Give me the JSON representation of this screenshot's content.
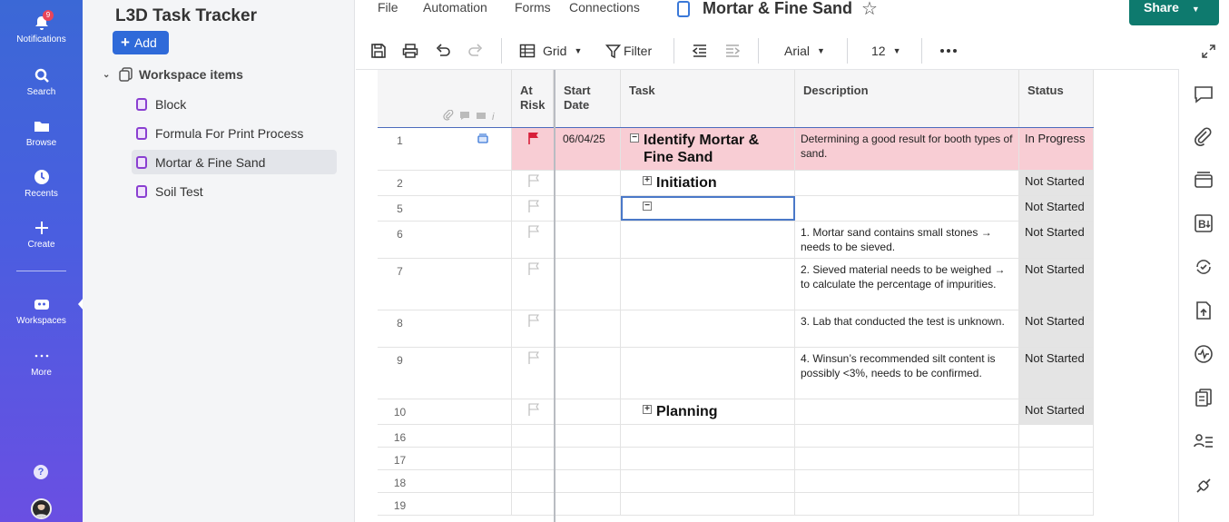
{
  "rail": {
    "notifications": {
      "label": "Notifications",
      "badge": "9"
    },
    "search": {
      "label": "Search"
    },
    "browse": {
      "label": "Browse"
    },
    "recents": {
      "label": "Recents"
    },
    "create": {
      "label": "Create"
    },
    "workspaces": {
      "label": "Workspaces"
    },
    "more": {
      "label": "More"
    },
    "help": "?"
  },
  "sidebar": {
    "workspace_title": "L3D Task Tracker",
    "add_label": "Add",
    "root_label": "Workspace items",
    "items": [
      {
        "label": "Block"
      },
      {
        "label": "Formula For Print Process"
      },
      {
        "label": "Mortar & Fine Sand",
        "selected": true
      },
      {
        "label": "Soil Test"
      }
    ]
  },
  "menubar": {
    "file": "File",
    "automation": "Automation",
    "forms": "Forms",
    "connections": "Connections",
    "doc_title": "Mortar & Fine Sand",
    "share": "Share"
  },
  "toolbar": {
    "view": "Grid",
    "filter": "Filter",
    "font": "Arial",
    "size": "12"
  },
  "grid": {
    "columns": {
      "at_risk": "At Risk",
      "start_date": "Start Date",
      "task": "Task",
      "description": "Description",
      "status": "Status"
    },
    "rows": [
      {
        "num": "1",
        "flag": "red",
        "start": "06/04/25",
        "task": "Identify Mortar & Fine Sand",
        "level": 0,
        "toggle": "minus",
        "desc": "Determining a good result for booth types of sand.",
        "status": "In Progress",
        "highlight": true
      },
      {
        "num": "2",
        "flag": "empty",
        "start": "",
        "task": "Initiation",
        "level": 1,
        "toggle": "plus",
        "desc": "",
        "status": "Not Started"
      },
      {
        "num": "5",
        "flag": "empty",
        "start": "",
        "task": "",
        "level": 1,
        "toggle": "minus",
        "desc": "",
        "status": "Not Started",
        "selected": true
      },
      {
        "num": "6",
        "flag": "empty",
        "start": "",
        "task": "",
        "desc": "1. Mortar sand contains small stones → needs to be sieved.",
        "status": "Not Started"
      },
      {
        "num": "7",
        "flag": "empty",
        "start": "",
        "task": "",
        "desc": "2. Sieved material needs to be weighed → to calculate the percentage of impurities.",
        "status": "Not Started"
      },
      {
        "num": "8",
        "flag": "empty",
        "start": "",
        "task": "",
        "desc": "3. Lab that conducted the test is unknown.",
        "status": "Not Started"
      },
      {
        "num": "9",
        "flag": "empty",
        "start": "",
        "task": "",
        "desc": "4. Winsun’s recommended silt content is possibly <3%, needs to be confirmed.",
        "status": "Not Started"
      },
      {
        "num": "10",
        "flag": "empty",
        "start": "",
        "task": "Planning",
        "level": 1,
        "toggle": "plus",
        "desc": "",
        "status": "Not Started"
      },
      {
        "num": "16"
      },
      {
        "num": "17"
      },
      {
        "num": "18"
      },
      {
        "num": "19"
      }
    ]
  },
  "colors": {
    "rail_top": "#3b68d6",
    "rail_bottom": "#6a4fe2",
    "share": "#0e7a6e",
    "add": "#2f6ad9",
    "highlight_row": "#f8cdd4",
    "status_bg": "#e4e4e4",
    "flag_red": "#d81f3a"
  }
}
